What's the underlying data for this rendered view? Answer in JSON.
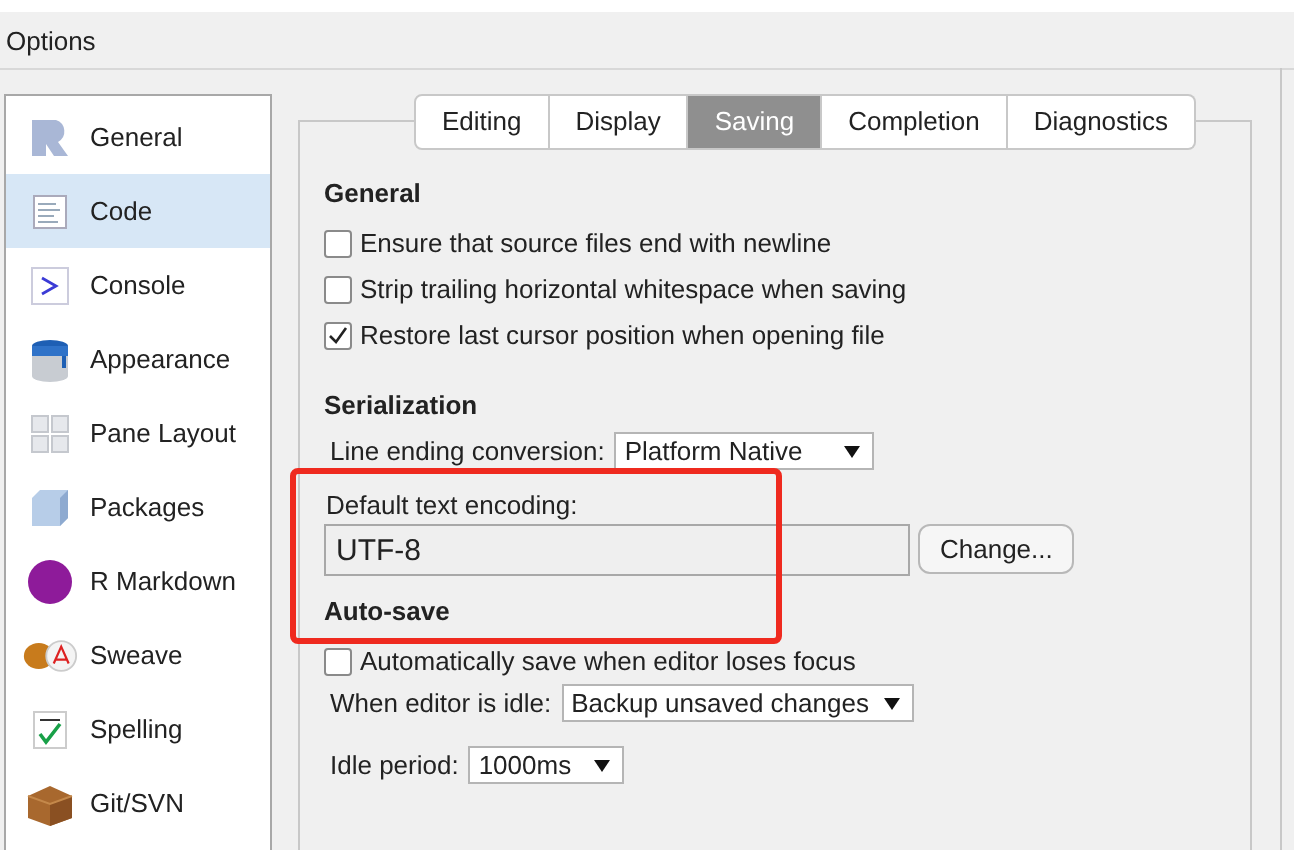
{
  "window": {
    "title": "Options"
  },
  "sidebar": {
    "items": [
      {
        "label": "General",
        "selected": false
      },
      {
        "label": "Code",
        "selected": true
      },
      {
        "label": "Console",
        "selected": false
      },
      {
        "label": "Appearance",
        "selected": false
      },
      {
        "label": "Pane Layout",
        "selected": false
      },
      {
        "label": "Packages",
        "selected": false
      },
      {
        "label": "R Markdown",
        "selected": false
      },
      {
        "label": "Sweave",
        "selected": false
      },
      {
        "label": "Spelling",
        "selected": false
      },
      {
        "label": "Git/SVN",
        "selected": false
      }
    ]
  },
  "tabs": [
    {
      "label": "Editing",
      "selected": false
    },
    {
      "label": "Display",
      "selected": false
    },
    {
      "label": "Saving",
      "selected": true
    },
    {
      "label": "Completion",
      "selected": false
    },
    {
      "label": "Diagnostics",
      "selected": false
    }
  ],
  "general": {
    "heading": "General",
    "checkboxes": [
      {
        "label": "Ensure that source files end with newline",
        "checked": false
      },
      {
        "label": "Strip trailing horizontal whitespace when saving",
        "checked": false
      },
      {
        "label": "Restore last cursor position when opening file",
        "checked": true
      }
    ]
  },
  "serialization": {
    "heading": "Serialization",
    "line_ending": {
      "label": "Line ending conversion:",
      "value": "Platform Native"
    },
    "encoding": {
      "label": "Default text encoding:",
      "value": "UTF-8",
      "button": "Change..."
    }
  },
  "auto_save": {
    "heading": "Auto-save",
    "checkbox": {
      "label": "Automatically save when editor loses focus",
      "checked": false
    },
    "idle_action": {
      "label": "When editor is idle:",
      "value": "Backup unsaved changes"
    },
    "idle_period": {
      "label": "Idle period:",
      "value": "1000ms"
    }
  }
}
